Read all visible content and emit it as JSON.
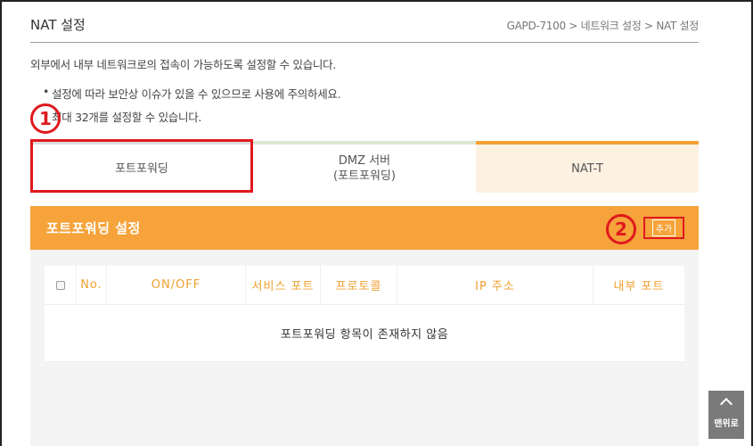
{
  "header": {
    "title": "NAT 설정",
    "breadcrumb": "GAPD-7100 > 네트워크 설정 > NAT 설정"
  },
  "description": "외부에서 내부 네트워크로의 접속이 가능하도록 설정할 수 있습니다.",
  "notes": [
    "설정에 따라 보안상 이슈가 있을 수 있으므로 사용에 주의하세요.",
    "최대 32개를 설정할 수 있습니다."
  ],
  "markers": [
    "1",
    "2"
  ],
  "tabs": [
    {
      "label": "포트포워딩"
    },
    {
      "label_line1": "DMZ 서버",
      "label_line2": "(포트포워딩)"
    },
    {
      "label": "NAT-T"
    }
  ],
  "panel": {
    "title": "포트포워딩 설정",
    "add_label": "추가"
  },
  "table": {
    "columns": [
      "No.",
      "ON/OFF",
      "서비스 포트",
      "프로토콜",
      "IP 주소",
      "내부 포트"
    ],
    "empty_message": "포트포워딩 항목이 존재하지 않음"
  },
  "scroll_top": {
    "label": "맨위로"
  },
  "colors": {
    "accent": "#f5a33a",
    "header_text": "#f0a030",
    "highlight": "#e0191e",
    "tab3_bg": "#fdf1e2"
  }
}
